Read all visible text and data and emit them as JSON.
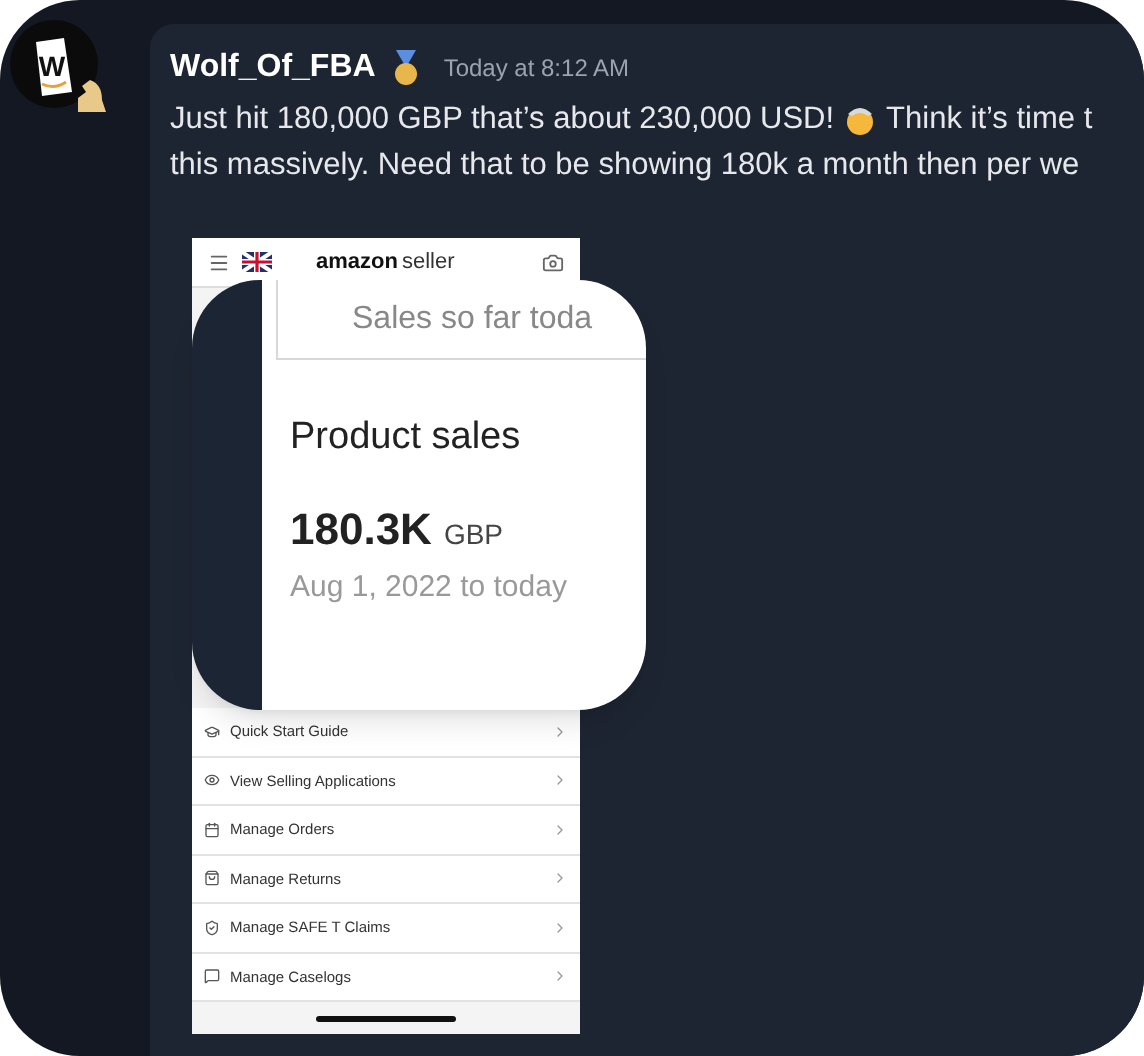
{
  "message": {
    "avatar_letter": "W",
    "author": "Wolf_Of_FBA",
    "timestamp": "Today at 8:12 AM",
    "line_1_start": "Just hit 180,000 GBP that’s about 230,000 USD!",
    "line_1_end": "Think it’s time t",
    "line_2": "this massively. Need that to be showing 180k a month then per we"
  },
  "attachment": {
    "brand": "amazon",
    "brand_suffix": "seller",
    "menu_items": [
      {
        "label": "Quick Start Guide",
        "kind": "cap"
      },
      {
        "label": "View Selling Applications",
        "kind": "eye"
      },
      {
        "label": "Manage Orders",
        "kind": "calendar"
      },
      {
        "label": "Manage Returns",
        "kind": "bag"
      },
      {
        "label": "Manage SAFE T Claims",
        "kind": "shield"
      },
      {
        "label": "Manage Caselogs",
        "kind": "chat"
      }
    ]
  },
  "zoom_card": {
    "subtitle": "Sales so far toda",
    "title": "Product sales",
    "value": "180.3K",
    "unit": "GBP",
    "period": "Aug 1, 2022 to today"
  }
}
